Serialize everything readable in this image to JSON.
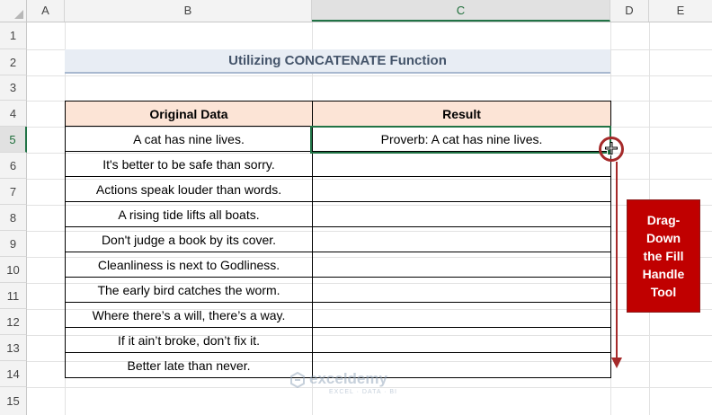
{
  "columns": [
    "A",
    "B",
    "C",
    "D",
    "E"
  ],
  "rows": [
    "1",
    "2",
    "3",
    "4",
    "5",
    "6",
    "7",
    "8",
    "9",
    "10",
    "11",
    "12",
    "13",
    "14",
    "15"
  ],
  "title": "Utilizing CONCATENATE Function",
  "table": {
    "headers": [
      "Original Data",
      "Result"
    ],
    "rows": [
      {
        "original": "A cat has nine lives.",
        "result": "Proverb: A cat has nine lives."
      },
      {
        "original": "It's better to be safe than sorry.",
        "result": ""
      },
      {
        "original": "Actions speak louder than words.",
        "result": ""
      },
      {
        "original": "A rising tide lifts all boats.",
        "result": ""
      },
      {
        "original": "Don't judge a book by its cover.",
        "result": ""
      },
      {
        "original": "Cleanliness is next to Godliness.",
        "result": ""
      },
      {
        "original": "The early bird catches the worm.",
        "result": ""
      },
      {
        "original": "Where there’s a will, there’s a way.",
        "result": ""
      },
      {
        "original": "If it ain’t broke, don’t fix it.",
        "result": ""
      },
      {
        "original": "Better late than never.",
        "result": ""
      }
    ]
  },
  "selection": {
    "column": "C",
    "row": "5"
  },
  "callout": "Drag-\nDown\nthe Fill\nHandle\nTool",
  "watermark": {
    "name": "exceldemy",
    "tagline": "EXCEL · DATA · BI"
  },
  "colors": {
    "header_fill": "#fce4d6",
    "title_fill": "#e8edf4",
    "title_text": "#44546a",
    "selection": "#217346",
    "annotation": "#a52a2a",
    "callout_fill": "#c00000"
  },
  "icons": [
    "fill-handle-crosshair-icon",
    "exceldemy-logo-icon"
  ]
}
